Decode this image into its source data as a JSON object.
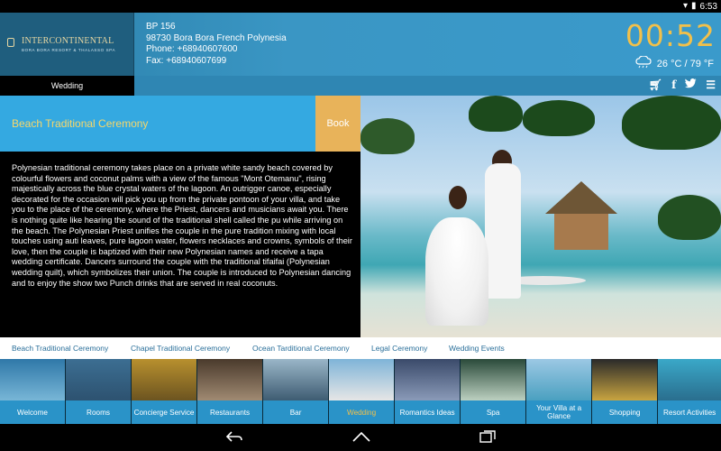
{
  "status_bar": {
    "time": "6:53",
    "battery_icon": "battery-icon",
    "wifi_icon": "wifi-icon"
  },
  "brand": {
    "name": "INTERCONTINENTAL",
    "tagline": "BORA BORA RESORT & THALASSO SPA"
  },
  "address": {
    "line1": "BP 156",
    "line2": "98730 Bora Bora French Polynesia",
    "phone": "Phone: +68940607600",
    "fax": "Fax: +68940607699"
  },
  "clock": {
    "time": "00:52"
  },
  "weather": {
    "text": "26 °C / 79 °F",
    "icon": "rain-cloud-icon"
  },
  "nav": {
    "current_tab": "Wedding",
    "icons": [
      "cart-icon",
      "facebook-icon",
      "twitter-icon",
      "menu-icon"
    ]
  },
  "panel": {
    "title": "Beach Traditional Ceremony",
    "book_label": "Book",
    "description": "Polynesian traditional ceremony takes place on a private white sandy beach covered by colourful flowers and coconut palms with a view of the famous \"Mont Otemanu\", rising majestically across the blue crystal waters of the lagoon. An outrigger canoe, especially decorated for the occasion will pick you up from the private pontoon of your villa, and take you to the place of the ceremony, where the Priest, dancers and musicians await you. There is nothing quite like hearing the sound of the traditional shell called the pu while arriving on the beach. The Polynesian Priest unifies the couple in the pure tradition mixing with local touches using auti leaves, pure lagoon water, flowers necklaces and crowns, symbols of their love, then the couple is baptized with their new Polynesian names and receive a tapa wedding certificate. Dancers surround the couple with the traditional tifaifai (Polynesian wedding quilt), which symbolizes their union. The couple is introduced to Polynesian dancing and to enjoy the show two Punch drinks that are served in real coconuts."
  },
  "category_tabs": [
    "Beach Traditional Ceremony",
    "Chapel Traditional Ceremony",
    "Ocean Tarditional Ceremony",
    "Legal Ceremony",
    "Wedding Events"
  ],
  "tiles": [
    {
      "label": "Welcome",
      "color_top": "#2f78a8",
      "color_bottom": "#78b6d6"
    },
    {
      "label": "Rooms",
      "color_top": "#3c6e92",
      "color_bottom": "#2d5270"
    },
    {
      "label": "Concierge Service",
      "color_top": "#b8902e",
      "color_bottom": "#6c5420"
    },
    {
      "label": "Restaurants",
      "color_top": "#4a3a2c",
      "color_bottom": "#a08a72"
    },
    {
      "label": "Bar",
      "color_top": "#9ab6c8",
      "color_bottom": "#3e5c72"
    },
    {
      "label": "Wedding",
      "color_top": "#7fb4d8",
      "color_bottom": "#e6e6e6"
    },
    {
      "label": "Romantics Ideas",
      "color_top": "#3a4a6a",
      "color_bottom": "#8a9ab8"
    },
    {
      "label": "Spa",
      "color_top": "#2a4a3a",
      "color_bottom": "#bcd0c0"
    },
    {
      "label": "Your Villa at a Glance",
      "color_top": "#9cc8e4",
      "color_bottom": "#4aa0c0"
    },
    {
      "label": "Shopping",
      "color_top": "#2a2a2a",
      "color_bottom": "#c8a440"
    },
    {
      "label": "Resort Activities",
      "color_top": "#3aa8c8",
      "color_bottom": "#2a6e8e"
    }
  ],
  "active_tile": "Wedding"
}
